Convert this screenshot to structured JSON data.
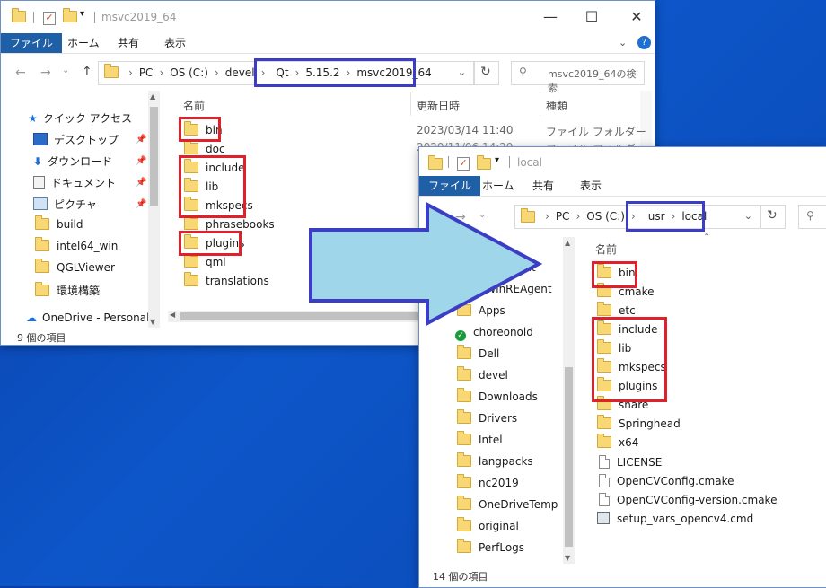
{
  "win1": {
    "title": "msvc2019_64",
    "tabs": [
      "ファイル",
      "ホーム",
      "共有",
      "表示"
    ],
    "breadcrumb": [
      "PC",
      "OS (C:)",
      "devel",
      "Qt",
      "5.15.2",
      "msvc2019_64"
    ],
    "search_placeholder": "msvc2019_64の検索",
    "col_name": "名前",
    "col_date": "更新日時",
    "col_type": "種類",
    "nav": {
      "quick_access": "クイック アクセス",
      "items": [
        "デスクトップ",
        "ダウンロード",
        "ドキュメント",
        "ピクチャ",
        "build",
        "intel64_win",
        "QGLViewer",
        "環境構築"
      ],
      "onedrive": "OneDrive - Personal"
    },
    "files": [
      "bin",
      "doc",
      "include",
      "lib",
      "mkspecs",
      "phrasebooks",
      "plugins",
      "qml",
      "translations"
    ],
    "row1_date": "2023/03/14 11:40",
    "row1_type": "ファイル フォルダー",
    "row2_date": "2020/11/06 14:29",
    "row2_type": "ファイル フォルダー",
    "status": "9 個の項目"
  },
  "win2": {
    "title": "local",
    "tabs": [
      "ファイル",
      "ホーム",
      "共有",
      "表示"
    ],
    "breadcrumb": [
      "PC",
      "OS (C:)",
      "usr",
      "local"
    ],
    "col_name": "名前",
    "nav_items": [
      "ent",
      "$WinREAgent",
      "Apps",
      "choreonoid",
      "Dell",
      "devel",
      "Downloads",
      "Drivers",
      "Intel",
      "langpacks",
      "nc2019",
      "OneDriveTemp",
      "original",
      "PerfLogs"
    ],
    "folders": [
      "bin",
      "cmake",
      "etc",
      "include",
      "lib",
      "mkspecs",
      "plugins",
      "share",
      "Springhead",
      "x64"
    ],
    "files": [
      "LICENSE",
      "OpenCVConfig.cmake",
      "OpenCVConfig-version.cmake",
      "setup_vars_opencv4.cmd"
    ],
    "status": "14 個の項目"
  },
  "colors": {
    "highlight_red": "#e0202a",
    "highlight_blue": "#3b3ec4",
    "arrow_fill": "#9fd6ea",
    "desktop": "#0d56c9"
  }
}
